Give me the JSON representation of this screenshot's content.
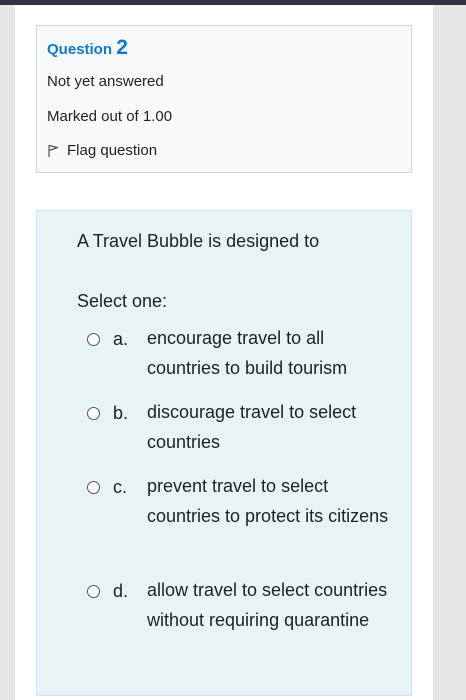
{
  "question": {
    "label": "Question",
    "number": "2",
    "state": "Not yet answered",
    "grade": "Marked out of 1.00",
    "flag_label": "Flag question"
  },
  "content": {
    "text": "A Travel Bubble is designed to",
    "prompt": "Select one:",
    "options": [
      {
        "letter": "a.",
        "text": "encourage travel to all countries to build tourism"
      },
      {
        "letter": "b.",
        "text": "discourage travel to select countries"
      },
      {
        "letter": "c.",
        "text": "prevent travel to select countries to protect its citizens"
      },
      {
        "letter": "d.",
        "text": "allow travel to select countries without requiring quarantine"
      }
    ]
  },
  "colors": {
    "accent": "#1177d1",
    "answer_bg": "#e7f3f5",
    "info_bg": "#f8f9fa"
  },
  "icons": {
    "flag": "flag-icon",
    "option": "radio-icon"
  }
}
